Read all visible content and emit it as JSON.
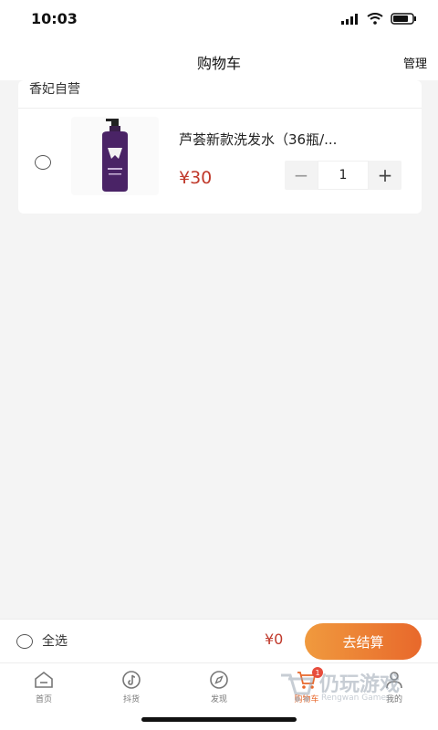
{
  "status_bar": {
    "time": "10:03"
  },
  "header": {
    "title": "购物车",
    "action": "管理"
  },
  "store": {
    "name": "香妃自营",
    "item": {
      "name": "芦荟新款洗发水（36瓶/...",
      "price": "¥30",
      "quantity": "1",
      "minus": "−",
      "plus": "+"
    }
  },
  "checkout": {
    "select_all": "全选",
    "total": "¥0",
    "button": "去结算"
  },
  "tabs": [
    {
      "label": "首页",
      "icon": "home-icon"
    },
    {
      "label": "抖货",
      "icon": "tiktok-icon"
    },
    {
      "label": "发现",
      "icon": "compass-icon"
    },
    {
      "label": "购物车",
      "icon": "cart-icon",
      "badge": "1"
    },
    {
      "label": "我的",
      "icon": "user-icon"
    }
  ],
  "watermark": {
    "text": "仍玩游戏",
    "sub": "Rengwan Games"
  },
  "colors": {
    "accent": "#e8682b",
    "price": "#c0392b",
    "background": "#f4f4f4"
  }
}
